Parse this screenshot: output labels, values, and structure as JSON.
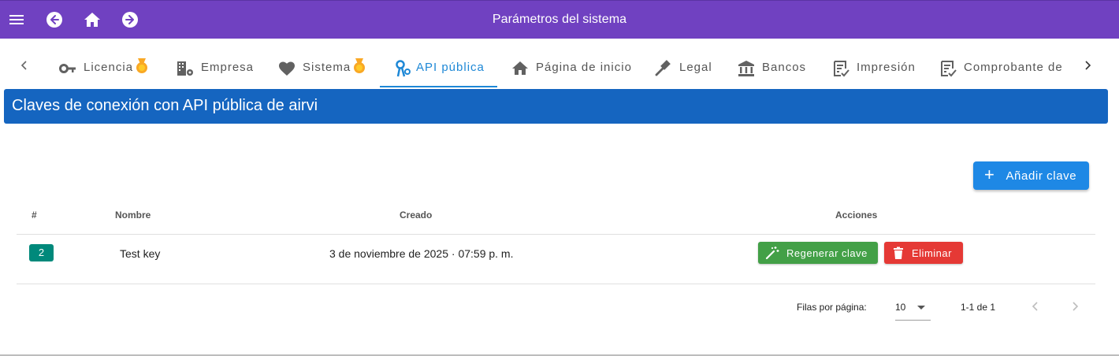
{
  "appbar": {
    "title": "Parámetros del sistema",
    "icons": [
      "menu-icon",
      "back-icon",
      "home-icon",
      "forward-icon"
    ],
    "color": "#7041c1"
  },
  "tabs": [
    {
      "label": "Licencia",
      "icon": "key-icon",
      "badge": "medal-icon",
      "active": false
    },
    {
      "label": "Empresa",
      "icon": "business-settings-icon",
      "active": false
    },
    {
      "label": "Sistema",
      "icon": "heart-icon",
      "badge": "medal-icon",
      "active": false
    },
    {
      "label": "API pública",
      "icon": "api-icon",
      "active": true
    },
    {
      "label": "Página de inicio",
      "icon": "home-icon",
      "active": false
    },
    {
      "label": "Legal",
      "icon": "gavel-icon",
      "active": false
    },
    {
      "label": "Bancos",
      "icon": "bank-icon",
      "active": false
    },
    {
      "label": "Impresión",
      "icon": "checklist-icon",
      "active": false
    },
    {
      "label": "Comprobante de r",
      "icon": "checklist-icon",
      "active": false
    }
  ],
  "section": {
    "title": "Claves de conexión con API pública de airvi",
    "color": "#1565c0"
  },
  "add_button": {
    "label": "Añadir clave",
    "icon": "plus-icon",
    "color": "#1e88e5"
  },
  "table": {
    "columns": [
      "#",
      "Nombre",
      "Creado",
      "Acciones"
    ],
    "rows": [
      {
        "id": "2",
        "name": "Test key",
        "created": "3 de noviembre de 2025 · 07:59 p. m."
      }
    ],
    "actions": {
      "regenerate": {
        "label": "Regenerar clave",
        "icon": "magic-wand-icon",
        "color": "#43a047"
      },
      "delete": {
        "label": "Eliminar",
        "icon": "trash-icon",
        "color": "#e53935"
      }
    }
  },
  "pagination": {
    "rows_per_page_label": "Filas por página:",
    "rows_per_page": "10",
    "range": "1-1 de 1"
  }
}
